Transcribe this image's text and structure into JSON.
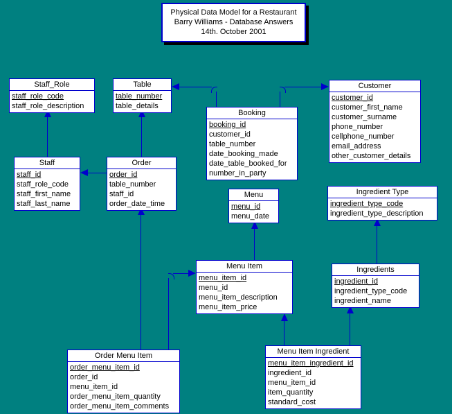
{
  "diagram": {
    "background_color": "#008080",
    "line_color": "#0000cc",
    "box_fill": "#ffffff",
    "title": {
      "line1": "Physical Data Model for a Restaurant",
      "line2": "Barry Williams - Database Answers",
      "line3": "14th. October 2001"
    },
    "entities": [
      {
        "key": "staff_role",
        "name": "Staff_Role",
        "attributes": [
          {
            "label": "staff_role_code",
            "pk": true
          },
          {
            "label": "staff_role_description",
            "pk": false
          }
        ]
      },
      {
        "key": "table",
        "name": "Table",
        "attributes": [
          {
            "label": "table_number",
            "pk": true
          },
          {
            "label": "table_details",
            "pk": false
          }
        ]
      },
      {
        "key": "customer",
        "name": "Customer",
        "attributes": [
          {
            "label": "customer_id",
            "pk": true
          },
          {
            "label": "customer_first_name",
            "pk": false
          },
          {
            "label": "customer_surname",
            "pk": false
          },
          {
            "label": "phone_number",
            "pk": false
          },
          {
            "label": "cellphone_number",
            "pk": false
          },
          {
            "label": "email_address",
            "pk": false
          },
          {
            "label": "other_customer_details",
            "pk": false
          }
        ]
      },
      {
        "key": "booking",
        "name": "Booking",
        "attributes": [
          {
            "label": "booking_id",
            "pk": true
          },
          {
            "label": "customer_id",
            "pk": false
          },
          {
            "label": "table_number",
            "pk": false
          },
          {
            "label": "date_booking_made",
            "pk": false
          },
          {
            "label": "date_table_booked_for",
            "pk": false
          },
          {
            "label": "number_in_party",
            "pk": false
          }
        ]
      },
      {
        "key": "staff",
        "name": "Staff",
        "attributes": [
          {
            "label": "staff_id",
            "pk": true
          },
          {
            "label": "staff_role_code",
            "pk": false
          },
          {
            "label": "staff_first_name",
            "pk": false
          },
          {
            "label": "staff_last_name",
            "pk": false
          }
        ]
      },
      {
        "key": "order",
        "name": "Order",
        "attributes": [
          {
            "label": "order_id",
            "pk": true
          },
          {
            "label": "table_number",
            "pk": false
          },
          {
            "label": "staff_id",
            "pk": false
          },
          {
            "label": "order_date_time",
            "pk": false
          }
        ]
      },
      {
        "key": "menu",
        "name": "Menu",
        "attributes": [
          {
            "label": "menu_id",
            "pk": true
          },
          {
            "label": "menu_date",
            "pk": false
          }
        ]
      },
      {
        "key": "ingredient_type",
        "name": "Ingredient Type",
        "attributes": [
          {
            "label": "ingredient_type_code",
            "pk": true
          },
          {
            "label": "ingredient_type_description",
            "pk": false
          }
        ]
      },
      {
        "key": "menu_item",
        "name": "Menu Item",
        "attributes": [
          {
            "label": "menu_item_id",
            "pk": true
          },
          {
            "label": "menu_id",
            "pk": false
          },
          {
            "label": "menu_item_description",
            "pk": false
          },
          {
            "label": "menu_item_price",
            "pk": false
          }
        ]
      },
      {
        "key": "ingredients",
        "name": "Ingredients",
        "attributes": [
          {
            "label": "ingredient_id",
            "pk": true
          },
          {
            "label": "ingredient_type_code",
            "pk": false
          },
          {
            "label": "ingredient_name",
            "pk": false
          }
        ]
      },
      {
        "key": "order_menu_item",
        "name": "Order Menu Item",
        "attributes": [
          {
            "label": "order_menu_item_id",
            "pk": true
          },
          {
            "label": "order_id",
            "pk": false
          },
          {
            "label": "menu_item_id",
            "pk": false
          },
          {
            "label": "order_menu_item_quantity",
            "pk": false
          },
          {
            "label": "order_menu_item_comments",
            "pk": false
          }
        ]
      },
      {
        "key": "menu_item_ingredient",
        "name": "Menu Item Ingredient",
        "attributes": [
          {
            "label": "menu_item_ingredient_id",
            "pk": true
          },
          {
            "label": "ingredient_id",
            "pk": false
          },
          {
            "label": "menu_item_id",
            "pk": false
          },
          {
            "label": "item_quantity",
            "pk": false
          },
          {
            "label": "standard_cost",
            "pk": false
          }
        ]
      }
    ],
    "relationships": [
      {
        "from": "staff",
        "to": "staff_role"
      },
      {
        "from": "order",
        "to": "table"
      },
      {
        "from": "order",
        "to": "staff"
      },
      {
        "from": "booking",
        "to": "table"
      },
      {
        "from": "booking",
        "to": "customer"
      },
      {
        "from": "menu_item",
        "to": "menu"
      },
      {
        "from": "order_menu_item",
        "to": "order"
      },
      {
        "from": "order_menu_item",
        "to": "menu_item"
      },
      {
        "from": "ingredients",
        "to": "ingredient_type"
      },
      {
        "from": "menu_item_ingredient",
        "to": "menu_item"
      },
      {
        "from": "menu_item_ingredient",
        "to": "ingredients"
      }
    ]
  }
}
